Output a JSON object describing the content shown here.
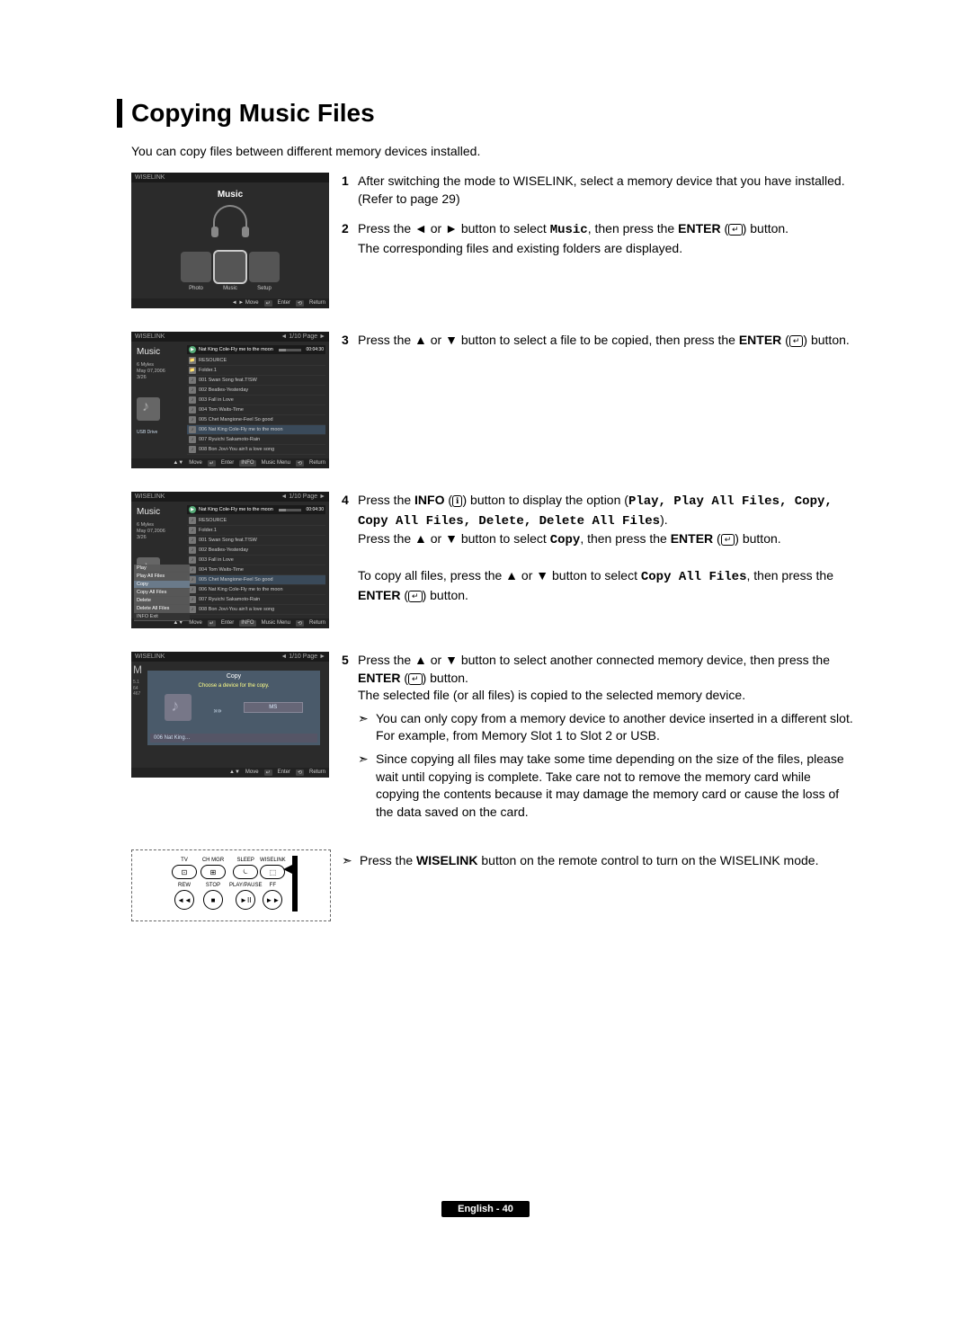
{
  "title": "Copying Music Files",
  "intro": "You can copy files between different memory devices installed.",
  "steps": {
    "s1": {
      "num": "1",
      "text": "After switching the mode to WISELINK, select a memory device that you have installed. (Refer to page 29)"
    },
    "s2": {
      "num": "2",
      "pre": "Press the ◄ or ► button to select ",
      "kw_music": "Music",
      "mid": ", then press the ",
      "enter": "ENTER",
      "post": " button.",
      "line2": "The corresponding files and existing folders are displayed."
    },
    "s3": {
      "num": "3",
      "pre": "Press the ▲ or ▼ button to select a file to be copied, then press the ",
      "enter": "ENTER",
      "post": " button."
    },
    "s4": {
      "num": "4",
      "l1a": "Press the ",
      "info": "INFO",
      "l1b": " button to display the option (",
      "opts": [
        "Play",
        "Play All Files",
        "Copy",
        "Copy All Files",
        "Delete",
        "Delete All Files"
      ],
      "l1c": ").",
      "l2a": "Press the ▲ or ▼ button to select ",
      "copy": "Copy",
      "l2b": ", then press the ",
      "enter": "ENTER",
      "l2c": " button.",
      "l3a": "To copy all files, press the ▲ or ▼ button to select ",
      "copyall": "Copy All Files",
      "l3b": ", then press the ",
      "l3c": " button."
    },
    "s5": {
      "num": "5",
      "l1a": "Press the ▲ or ▼ button to select another connected memory device, then press the ",
      "enter": "ENTER",
      "l1b": " button.",
      "l2": "The selected file (or all files) is copied to the selected memory device.",
      "b1": "You can only copy from a memory device to another device inserted in a different slot. For example, from Memory Slot 1 to Slot 2 or USB.",
      "b2": "Since copying all files may take some time depending on the size of the files, please wait until copying is complete. Take care not to remove the memory card while copying the contents because it may damage the memory card or cause the loss of the data saved on the card."
    },
    "tip": {
      "pre": "Press the ",
      "wl": "WISELINK",
      "post": " button on the remote control to turn on the WISELINK mode."
    }
  },
  "shot1": {
    "brand": "WISELINK",
    "title": "Music",
    "tiles": [
      {
        "label": "Photo"
      },
      {
        "label": "Music"
      },
      {
        "label": "Setup"
      }
    ],
    "foot": [
      "◄ ► Move",
      "Enter",
      "Return"
    ]
  },
  "shot2": {
    "brand": "WISELINK",
    "page": "◄ 1/10 Page ►",
    "category": "Music",
    "meta": [
      "6 Myles",
      "May 07,2006",
      "3/26"
    ],
    "usb": "USB Drive",
    "nowplaying": {
      "title": "Nat King Cole-Fly me to the moon",
      "time": "00:04:30"
    },
    "files": [
      {
        "ico": "📁",
        "name": "RESOURCE"
      },
      {
        "ico": "📁",
        "name": "Folder.1"
      },
      {
        "ico": "♪",
        "name": "001  Swan Song feat.T!SW"
      },
      {
        "ico": "♪",
        "name": "002  Beatles-Yesterday"
      },
      {
        "ico": "♪",
        "name": "003  Fall in Love"
      },
      {
        "ico": "♪",
        "name": "004  Tom Waits-Time"
      },
      {
        "ico": "♪",
        "name": "005  Chet Mangione-Feel So good"
      },
      {
        "ico": "♪",
        "name": "006  Nat King Cole-Fly me to the moon",
        "hl": true
      },
      {
        "ico": "♪",
        "name": "007  Ryuichi Sakamoto-Rain"
      },
      {
        "ico": "♪",
        "name": "008  Bon Jovi-You ain't a love song"
      }
    ],
    "foot": [
      "Move",
      "Enter",
      "INFO",
      "Music Menu",
      "Return"
    ]
  },
  "shot3": {
    "brand": "WISELINK",
    "page": "◄ 1/10 Page ►",
    "category": "Music",
    "meta": [
      "6 Myles",
      "May 07,2006",
      "3/26"
    ],
    "nowplaying": {
      "title": "Nat King Cole-Fly me to the moon",
      "time": "00:04:30"
    },
    "files": [
      {
        "name": "RESOURCE"
      },
      {
        "name": "Folder.1"
      },
      {
        "name": "001  Swan Song feat.T!SW"
      },
      {
        "name": "002  Beatles-Yesterday"
      },
      {
        "name": "003  Fall in Love"
      },
      {
        "name": "004  Tom Waits-Time"
      },
      {
        "name": "005  Chet Mangione-Feel So good",
        "hl": true
      },
      {
        "name": "006  Nat King Cole-Fly me to the moon"
      },
      {
        "name": "007  Ryuichi Sakamoto-Rain"
      },
      {
        "name": "008  Bon Jovi-You ain't a love song"
      }
    ],
    "menu": [
      "Play",
      "Play All Files",
      "Copy",
      "Copy All Files",
      "Delete",
      "Delete All Files"
    ],
    "menu_footer": "INFO  Exit"
  },
  "shot4": {
    "brand": "WISELINK",
    "page": "◄ 1/10 Page ►",
    "side_letter": "M",
    "side_nums": [
      "5.1",
      "64",
      "467"
    ],
    "dlg_title": "Copy",
    "dlg_msg": "Choose a device for the copy.",
    "device": "MS",
    "source": "006  Nat King…",
    "foot": [
      "Move",
      "Enter",
      "Return"
    ]
  },
  "remote": {
    "row1": [
      "TV",
      "CH MGR",
      "SLEEP",
      "WISELINK"
    ],
    "row2": [
      "REW",
      "STOP",
      "PLAY/PAUSE",
      "FF"
    ],
    "glyphs": [
      "◄◄",
      "■",
      "►II",
      "►►"
    ]
  },
  "footer": "English - 40"
}
